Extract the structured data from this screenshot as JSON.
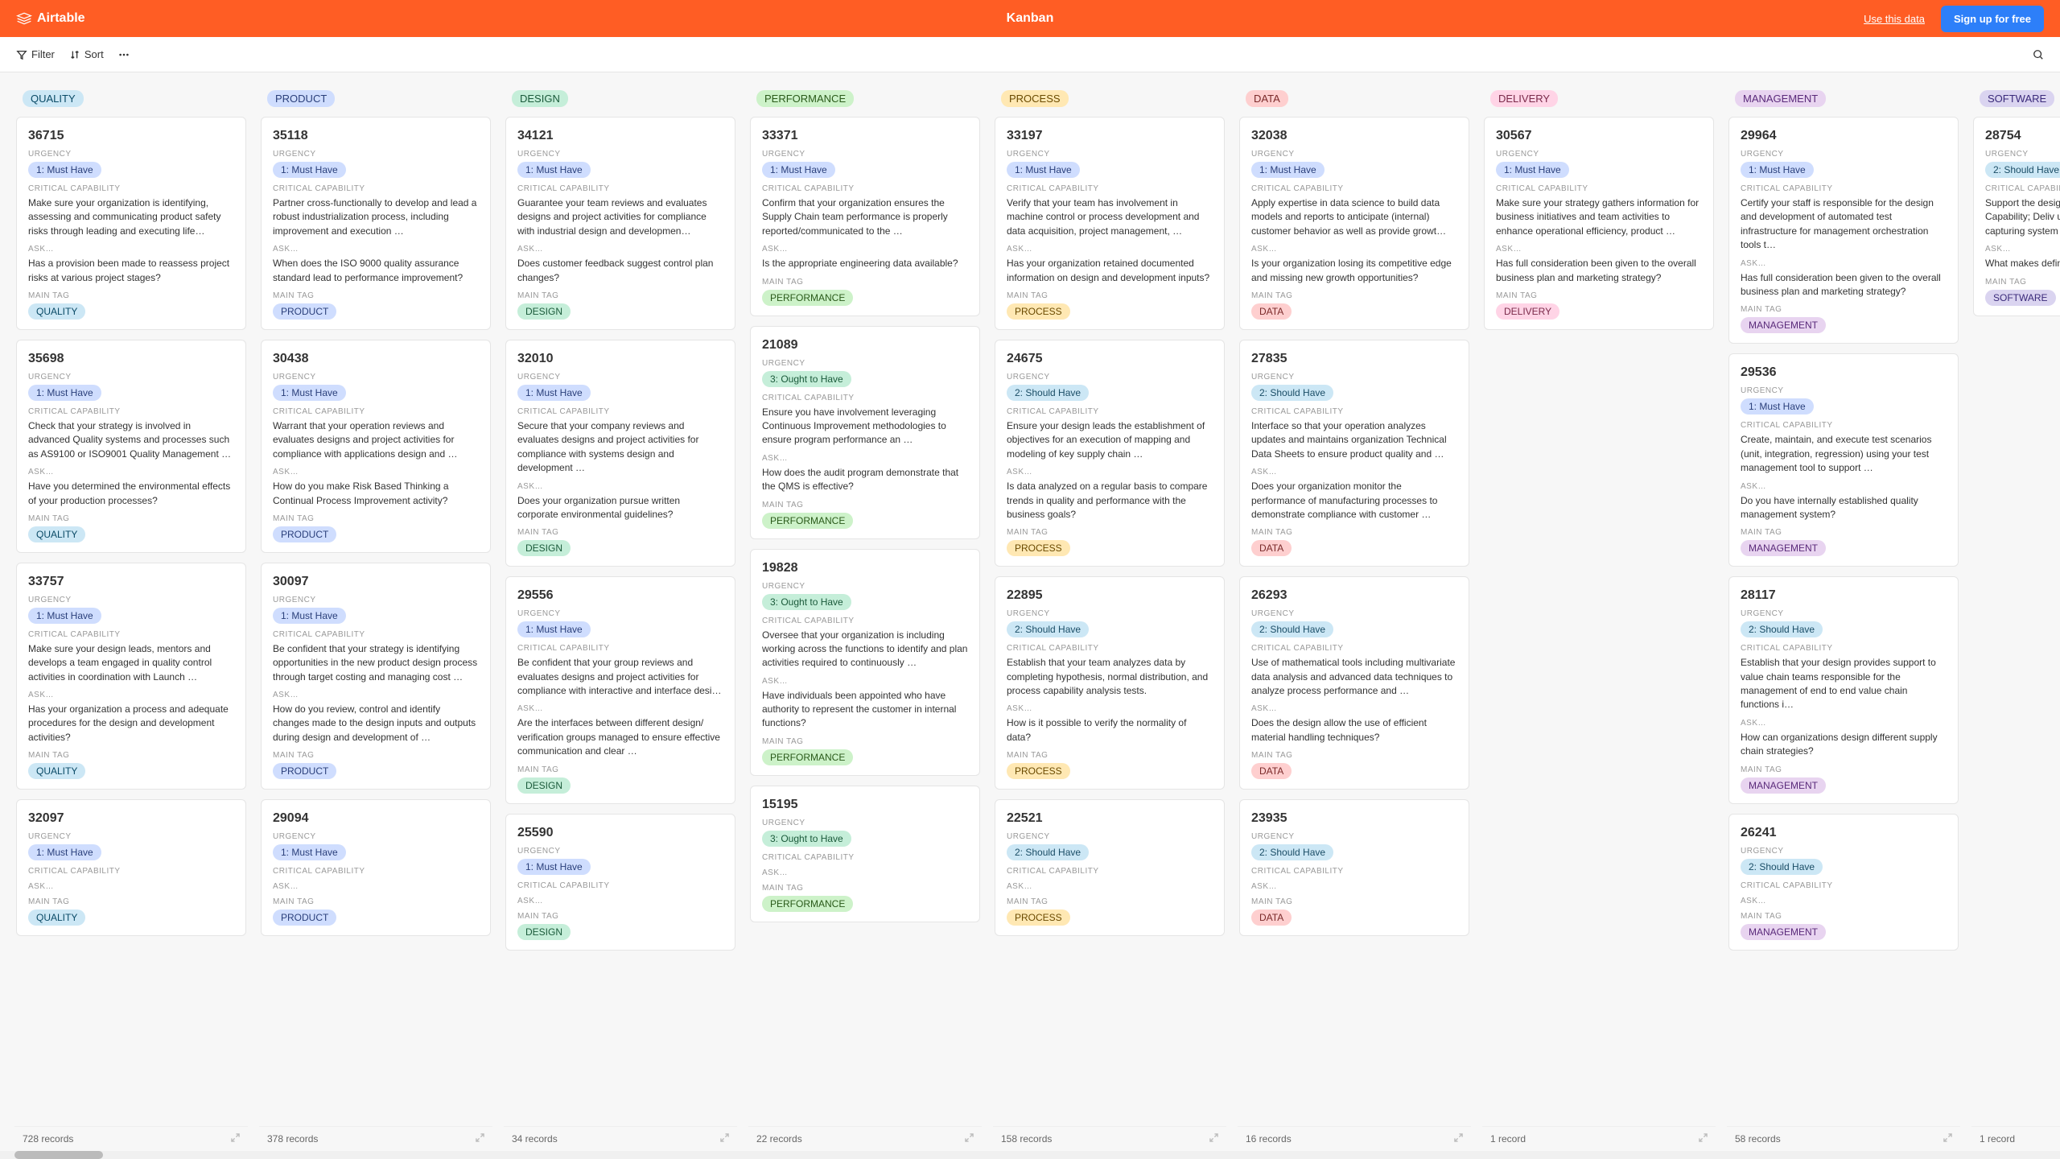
{
  "header": {
    "brand": "Airtable",
    "title": "Kanban",
    "use_data": "Use this data",
    "signup": "Sign up for free"
  },
  "toolbar": {
    "filter": "Filter",
    "sort": "Sort"
  },
  "labels": {
    "urgency": "URGENCY",
    "critical": "CRITICAL CAPABILITY",
    "ask": "ASK…",
    "main_tag": "MAIN TAG"
  },
  "urgency_values": {
    "must": "1: Must Have",
    "should": "2: Should Have",
    "ought": "3: Ought to Have"
  },
  "columns": [
    {
      "name": "QUALITY",
      "badge_class": "c-quality",
      "tag_class": "c-quality",
      "records": "728 records",
      "cards": [
        {
          "id": "36715",
          "urgency": "must",
          "critical": "Make sure your organization is identifying, assessing and communicating product safety risks through leading and executing life…",
          "ask": "Has a provision been made to reassess project risks at various project stages?",
          "tag": "QUALITY"
        },
        {
          "id": "35698",
          "urgency": "must",
          "critical": "Check that your strategy is involved in advanced Quality systems and processes such as AS9100 or ISO9001 Quality Management …",
          "ask": "Have you determined the environmental effects of your production processes?",
          "tag": "QUALITY"
        },
        {
          "id": "33757",
          "urgency": "must",
          "critical": "Make sure your design leads, mentors and develops a team engaged in quality control activities in coordination with Launch …",
          "ask": "Has your organization a process and adequate procedures for the design and development activities?",
          "tag": "QUALITY"
        },
        {
          "id": "32097",
          "urgency": "must",
          "critical": "",
          "ask": "",
          "tag": "QUALITY"
        }
      ]
    },
    {
      "name": "PRODUCT",
      "badge_class": "c-product",
      "tag_class": "c-product",
      "records": "378 records",
      "cards": [
        {
          "id": "35118",
          "urgency": "must",
          "critical": "Partner cross-functionally to develop and lead a robust industrialization process, including improvement and execution …",
          "ask": "When does the ISO 9000 quality assurance standard lead to performance improvement?",
          "tag": "PRODUCT"
        },
        {
          "id": "30438",
          "urgency": "must",
          "critical": "Warrant that your operation reviews and evaluates designs and project activities for compliance with applications design and …",
          "ask": "How do you make Risk Based Thinking a Continual Process Improvement activity?",
          "tag": "PRODUCT"
        },
        {
          "id": "30097",
          "urgency": "must",
          "critical": "Be confident that your strategy is identifying opportunities in the new product design process through target costing and managing cost …",
          "ask": "How do you review, control and identify changes made to the design inputs and outputs during design and development of …",
          "tag": "PRODUCT"
        },
        {
          "id": "29094",
          "urgency": "must",
          "critical": "",
          "ask": "",
          "tag": "PRODUCT"
        }
      ]
    },
    {
      "name": "DESIGN",
      "badge_class": "c-design",
      "tag_class": "c-design",
      "records": "34 records",
      "cards": [
        {
          "id": "34121",
          "urgency": "must",
          "critical": "Guarantee your team reviews and evaluates designs and project activities for compliance with industrial design and developmen…",
          "ask": "Does customer feedback suggest control plan changes?",
          "tag": "DESIGN"
        },
        {
          "id": "32010",
          "urgency": "must",
          "critical": "Secure that your company reviews and evaluates designs and project activities for compliance with systems design and development …",
          "ask": "Does your organization pursue written corporate environmental guidelines?",
          "tag": "DESIGN"
        },
        {
          "id": "29556",
          "urgency": "must",
          "critical": "Be confident that your group reviews and evaluates designs and project activities for compliance with interactive and interface desi…",
          "ask": "Are the interfaces between different design/ verification groups managed to ensure effective communication and clear …",
          "tag": "DESIGN"
        },
        {
          "id": "25590",
          "urgency": "must",
          "critical": "",
          "ask": "",
          "tag": "DESIGN"
        }
      ]
    },
    {
      "name": "PERFORMANCE",
      "badge_class": "c-performance",
      "tag_class": "c-performance",
      "records": "22 records",
      "cards": [
        {
          "id": "33371",
          "urgency": "must",
          "critical": "Confirm that your organization ensures the Supply Chain team performance is properly reported/communicated to the …",
          "ask": "Is the appropriate engineering data available?",
          "tag": "PERFORMANCE"
        },
        {
          "id": "21089",
          "urgency": "ought",
          "critical": "Ensure you have involvement leveraging Continuous Improvement methodologies to ensure program performance an …",
          "ask": "How does the audit program demonstrate that the QMS is effective?",
          "tag": "PERFORMANCE"
        },
        {
          "id": "19828",
          "urgency": "ought",
          "critical": "Oversee that your organization is including working across the functions to identify and plan activities required to continuously …",
          "ask": "Have individuals been appointed who have authority to represent the customer in internal functions?",
          "tag": "PERFORMANCE"
        },
        {
          "id": "15195",
          "urgency": "ought",
          "critical": "",
          "ask": "",
          "tag": "PERFORMANCE"
        }
      ]
    },
    {
      "name": "PROCESS",
      "badge_class": "c-process",
      "tag_class": "c-process",
      "records": "158 records",
      "cards": [
        {
          "id": "33197",
          "urgency": "must",
          "critical": "Verify that your team has involvement in machine control or process development and data acquisition, project management, …",
          "ask": "Has your organization retained documented information on design and development inputs?",
          "tag": "PROCESS"
        },
        {
          "id": "24675",
          "urgency": "should",
          "critical": "Ensure your design leads the establishment of objectives for an execution of mapping and modeling of key supply chain …",
          "ask": "Is data analyzed on a regular basis to compare trends in quality and performance with the business goals?",
          "tag": "PROCESS"
        },
        {
          "id": "22895",
          "urgency": "should",
          "critical": "Establish that your team analyzes data by completing hypothesis, normal distribution, and process capability analysis tests.",
          "ask": "How is it possible to verify the normality of data?",
          "tag": "PROCESS"
        },
        {
          "id": "22521",
          "urgency": "should",
          "critical": "",
          "ask": "",
          "tag": "PROCESS"
        }
      ]
    },
    {
      "name": "DATA",
      "badge_class": "c-data",
      "tag_class": "c-data",
      "records": "16 records",
      "cards": [
        {
          "id": "32038",
          "urgency": "must",
          "critical": "Apply expertise in data science to build data models and reports to anticipate (internal) customer behavior as well as provide growt…",
          "ask": "Is your organization losing its competitive edge and missing new growth opportunities?",
          "tag": "DATA"
        },
        {
          "id": "27835",
          "urgency": "should",
          "critical": "Interface so that your operation analyzes updates and maintains organization Technical Data Sheets to ensure product quality and …",
          "ask": "Does your organization monitor the performance of manufacturing processes to demonstrate compliance with customer …",
          "tag": "DATA"
        },
        {
          "id": "26293",
          "urgency": "should",
          "critical": "Use of mathematical tools including multivariate data analysis and advanced data techniques to analyze process performance and …",
          "ask": "Does the design allow the use of efficient material handling techniques?",
          "tag": "DATA"
        },
        {
          "id": "23935",
          "urgency": "should",
          "critical": "",
          "ask": "",
          "tag": "DATA"
        }
      ]
    },
    {
      "name": "DELIVERY",
      "badge_class": "c-delivery",
      "tag_class": "c-delivery",
      "records": "1 record",
      "cards": [
        {
          "id": "30567",
          "urgency": "must",
          "critical": "Make sure your strategy gathers information for business initiatives and team activities to enhance operational efficiency, product …",
          "ask": "Has full consideration been given to the overall business plan and marketing strategy?",
          "tag": "DELIVERY"
        }
      ]
    },
    {
      "name": "MANAGEMENT",
      "badge_class": "c-management",
      "tag_class": "c-management",
      "records": "58 records",
      "cards": [
        {
          "id": "29964",
          "urgency": "must",
          "critical": "Certify your staff is responsible for the design and development of automated test infrastructure for management orchestration tools t…",
          "ask": "Has full consideration been given to the overall business plan and marketing strategy?",
          "tag": "MANAGEMENT"
        },
        {
          "id": "29536",
          "urgency": "must",
          "critical": "Create, maintain, and execute test scenarios (unit, integration, regression) using your test management tool to support …",
          "ask": "Do you have internally established quality management system?",
          "tag": "MANAGEMENT"
        },
        {
          "id": "28117",
          "urgency": "should",
          "critical": "Establish that your design provides support to value chain teams responsible for the management of end to end value chain functions i…",
          "ask": "How can organizations design different supply chain strategies?",
          "tag": "MANAGEMENT"
        },
        {
          "id": "26241",
          "urgency": "should",
          "critical": "",
          "ask": "",
          "tag": "MANAGEMENT"
        }
      ]
    },
    {
      "name": "SOFTWARE",
      "badge_class": "c-software",
      "tag_class": "c-software",
      "records": "1 record",
      "cards": [
        {
          "id": "28754",
          "urgency": "should",
          "critical": "Support the design of an imp approach to Capability; Deliv using modeling as a tool for capturing system knowledge",
          "ask": "What makes defining Softwar Quality difficult?",
          "tag": "SOFTWARE"
        }
      ]
    }
  ]
}
